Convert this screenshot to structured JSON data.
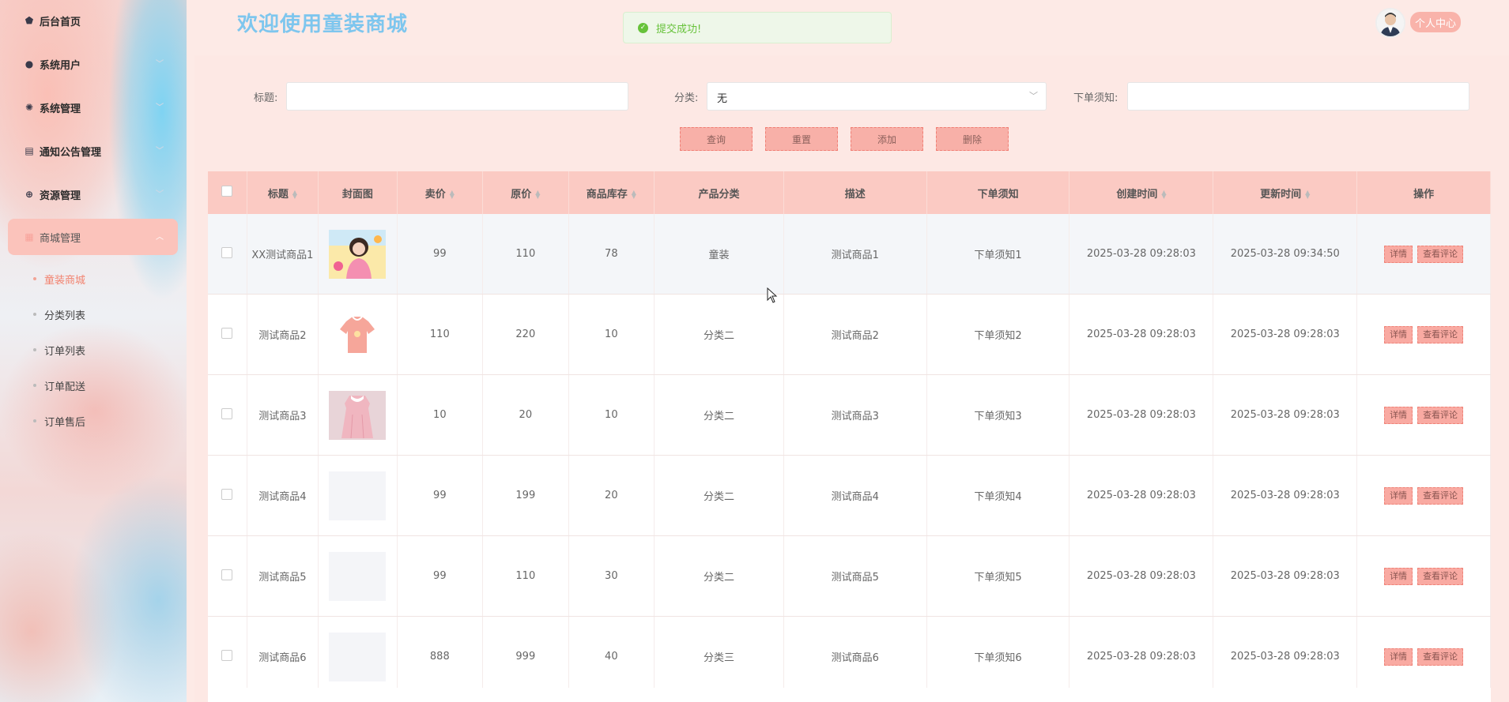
{
  "app_title": "欢迎使用童装商城",
  "toast": "提交成功!",
  "user_center": "个人中心",
  "sidebar": {
    "items": [
      {
        "label": "后台首页",
        "icon": "home-icon"
      },
      {
        "label": "系统用户",
        "icon": "user-icon"
      },
      {
        "label": "系统管理",
        "icon": "gear-icon"
      },
      {
        "label": "通知公告管理",
        "icon": "document-icon"
      },
      {
        "label": "资源管理",
        "icon": "plus-circle-icon"
      },
      {
        "label": "商城管理",
        "icon": "grid-icon"
      }
    ],
    "sub_items": [
      "童装商城",
      "分类列表",
      "订单列表",
      "订单配送",
      "订单售后"
    ],
    "current_sub": "童装商城"
  },
  "filters": {
    "title_label": "标题:",
    "title_value": "",
    "category_label": "分类:",
    "category_value": "无",
    "notice_label": "下单须知:",
    "notice_value": ""
  },
  "buttons": {
    "search": "查询",
    "reset": "重置",
    "add": "添加",
    "delete": "删除"
  },
  "table": {
    "headers": [
      "标题",
      "封面图",
      "卖价",
      "原价",
      "商品库存",
      "产品分类",
      "描述",
      "下单须知",
      "创建时间",
      "更新时间",
      "操作"
    ],
    "action_labels": {
      "detail": "详情",
      "comments": "查看评论"
    },
    "rows": [
      {
        "title": "XX测试商品1",
        "price": "99",
        "original": "110",
        "stock": "78",
        "category": "童装",
        "desc": "测试商品1",
        "notice": "下单须知1",
        "created": "2025-03-28 09:28:03",
        "updated": "2025-03-28 09:34:50"
      },
      {
        "title": "测试商品2",
        "price": "110",
        "original": "220",
        "stock": "10",
        "category": "分类二",
        "desc": "测试商品2",
        "notice": "下单须知2",
        "created": "2025-03-28 09:28:03",
        "updated": "2025-03-28 09:28:03"
      },
      {
        "title": "测试商品3",
        "price": "10",
        "original": "20",
        "stock": "10",
        "category": "分类二",
        "desc": "测试商品3",
        "notice": "下单须知3",
        "created": "2025-03-28 09:28:03",
        "updated": "2025-03-28 09:28:03"
      },
      {
        "title": "测试商品4",
        "price": "99",
        "original": "199",
        "stock": "20",
        "category": "分类二",
        "desc": "测试商品4",
        "notice": "下单须知4",
        "created": "2025-03-28 09:28:03",
        "updated": "2025-03-28 09:28:03"
      },
      {
        "title": "测试商品5",
        "price": "99",
        "original": "110",
        "stock": "30",
        "category": "分类二",
        "desc": "测试商品5",
        "notice": "下单须知5",
        "created": "2025-03-28 09:28:03",
        "updated": "2025-03-28 09:28:03"
      },
      {
        "title": "测试商品6",
        "price": "888",
        "original": "999",
        "stock": "40",
        "category": "分类三",
        "desc": "测试商品6",
        "notice": "下单须知6",
        "created": "2025-03-28 09:28:03",
        "updated": "2025-03-28 09:28:03"
      }
    ]
  },
  "colors": {
    "accent": "#fbc3bb",
    "title": "#7ec6ee",
    "success": "#67c23a"
  }
}
